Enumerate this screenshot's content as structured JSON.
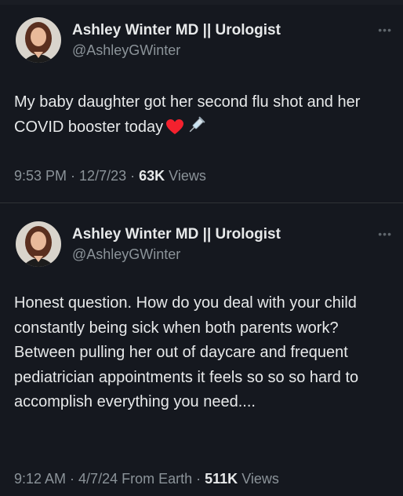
{
  "tweets": [
    {
      "author_name": "Ashley Winter MD || Urologist",
      "handle": "@AshleyGWinter",
      "more_icon": "more-options-icon",
      "text": "My baby daughter got her second flu shot and her COVID booster today",
      "emojis": [
        "red-heart-icon",
        "syringe-icon"
      ],
      "time": "9:53 PM",
      "date": "12/7/23",
      "source": "",
      "views_count": "63K",
      "views_label": "Views"
    },
    {
      "author_name": "Ashley Winter MD || Urologist",
      "handle": "@AshleyGWinter",
      "more_icon": "more-options-icon",
      "text": "Honest question. How do you deal with your child constantly being sick when both parents work? Between pulling her out of daycare and frequent pediatrician appointments it feels so so so hard to accomplish everything you need....",
      "time": "9:12 AM",
      "date": "4/7/24",
      "source": "From Earth",
      "views_count": "511K",
      "views_label": "Views"
    }
  ],
  "colors": {
    "background": "#15181f",
    "primary_text": "#e7e9ea",
    "secondary_text": "#8b9399",
    "heart": "#f4212e"
  }
}
